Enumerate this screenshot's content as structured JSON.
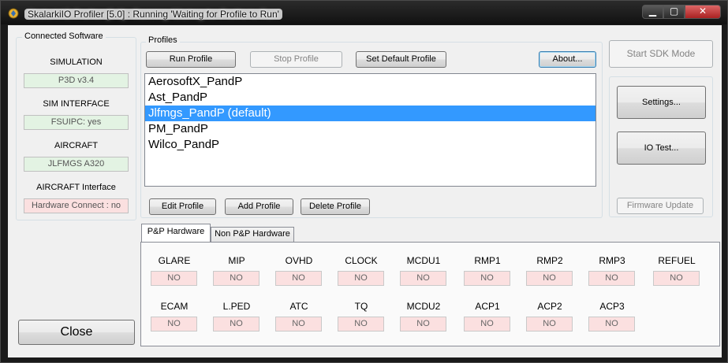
{
  "window": {
    "title": "SkalarkiIO Profiler [5.0] : Running 'Waiting for Profile to Run'",
    "min_glyph": "▁",
    "max_glyph": "▢",
    "close_glyph": "✕",
    "icon": "app-icon"
  },
  "connected": {
    "group_label": "Connected Software",
    "items": [
      {
        "label": "SIMULATION",
        "value": "P3D v3.4",
        "status": "ok"
      },
      {
        "label": "SIM INTERFACE",
        "value": "FSUIPC: yes",
        "status": "ok"
      },
      {
        "label": "AIRCRAFT",
        "value": "JLFMGS A320",
        "status": "ok"
      },
      {
        "label": "AIRCRAFT Interface",
        "value": "Hardware Connect : no",
        "status": "error"
      }
    ],
    "close_label": "Close"
  },
  "profiles": {
    "group_label": "Profiles",
    "run_label": "Run Profile",
    "stop_label": "Stop Profile",
    "set_default_label": "Set Default Profile",
    "about_label": "About...",
    "list": [
      "AerosoftX_PandP",
      "Ast_PandP",
      "Jlfmgs_PandP (default)",
      "PM_PandP",
      "Wilco_PandP"
    ],
    "selected_index": 2,
    "edit_label": "Edit Profile",
    "add_label": "Add Profile",
    "delete_label": "Delete Profile"
  },
  "right": {
    "sdk_label": "Start SDK Mode",
    "settings_label": "Settings...",
    "iotest_label": "IO Test...",
    "firmware_label": "Firmware Update"
  },
  "hardware": {
    "tabs": [
      "P&P Hardware",
      "Non P&P Hardware"
    ],
    "active_tab": 0,
    "row1": [
      {
        "label": "GLARE",
        "value": "NO"
      },
      {
        "label": "MIP",
        "value": "NO"
      },
      {
        "label": "OVHD",
        "value": "NO"
      },
      {
        "label": "CLOCK",
        "value": "NO"
      },
      {
        "label": "MCDU1",
        "value": "NO"
      },
      {
        "label": "RMP1",
        "value": "NO"
      },
      {
        "label": "RMP2",
        "value": "NO"
      },
      {
        "label": "RMP3",
        "value": "NO"
      },
      {
        "label": "REFUEL",
        "value": "NO"
      }
    ],
    "row2": [
      {
        "label": "ECAM",
        "value": "NO"
      },
      {
        "label": "L.PED",
        "value": "NO"
      },
      {
        "label": "ATC",
        "value": "NO"
      },
      {
        "label": "TQ",
        "value": "NO"
      },
      {
        "label": "MCDU2",
        "value": "NO"
      },
      {
        "label": "ACP1",
        "value": "NO"
      },
      {
        "label": "ACP2",
        "value": "NO"
      },
      {
        "label": "ACP3",
        "value": "NO"
      }
    ]
  },
  "colors": {
    "ok_field": "#e3f3e3",
    "error_field": "#fbe0e0",
    "selection": "#3399ff"
  }
}
